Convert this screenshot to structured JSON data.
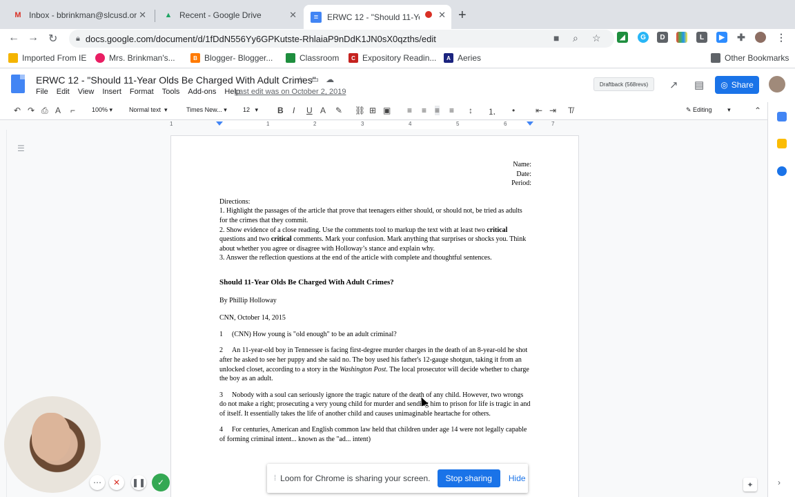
{
  "tabs": [
    {
      "title": "Inbox - bbrinkman@slcusd.org",
      "icon": "gmail-icon",
      "glyph": "M",
      "color": "#d93025"
    },
    {
      "title": "Recent - Google Drive",
      "icon": "drive-icon",
      "glyph": "▲",
      "color": "#1fa463"
    },
    {
      "title": "ERWC 12 - \"Should 11-Year",
      "icon": "docs-icon",
      "glyph": "≡",
      "color": "#4285f4"
    }
  ],
  "address": {
    "url": "docs.google.com/document/d/1fDdN556Yy6GPKutste-RhlaiaP9nDdK1JN0sX0qzths/edit"
  },
  "bookmarks": [
    {
      "label": "Imported From IE",
      "color": "#f4b400"
    },
    {
      "label": "Mrs. Brinkman's...",
      "color": "#e91e63"
    },
    {
      "label": "Blogger- Blogger...",
      "color": "#ff7a00"
    },
    {
      "label": "Classroom",
      "color": "#1e8e3e"
    },
    {
      "label": "Expository Readin...",
      "color": "#c5221f"
    },
    {
      "label": "Aeries",
      "color": "#1a237e"
    }
  ],
  "other_bookmarks": "Other Bookmarks",
  "doc": {
    "title": "ERWC 12 - \"Should 11-Year Olds Be Charged With Adult Crimes\"",
    "menu": [
      "File",
      "Edit",
      "View",
      "Insert",
      "Format",
      "Tools",
      "Add-ons",
      "Help"
    ],
    "last_edit": "Last edit was on October 2, 2019",
    "draftback": "Draftback (568revs)",
    "share": "Share"
  },
  "format": {
    "zoom": "100%",
    "style": "Normal text",
    "font": "Times New...",
    "size": "12",
    "mode": "Editing"
  },
  "ruler_ticks": [
    "1",
    "1",
    "2",
    "3",
    "4",
    "5",
    "6",
    "7"
  ],
  "content": {
    "name": "Name:",
    "date": "Date:",
    "period": "Period:",
    "directions": "Directions:",
    "d1": "1. Highlight the passages of the article that prove that teenagers either should, or should not, be tried as adults for the crimes that they commit.",
    "d2a": "2. Show evidence of a close reading. Use the comments tool to markup the text with at least two",
    "d2b": "critical",
    "d2c": " questions and two ",
    "d2d": "critical",
    "d2e": " comments. Mark your confusion.  Mark anything that surprises or shocks you.  Think about whether you agree or disagree with Holloway’s stance and explain why.",
    "d3": "3. Answer the reflection questions at the end of the article with complete and thoughtful sentences.",
    "article_title": "Should 11-Year Olds Be Charged With Adult Crimes?",
    "byline": "By Phillip Holloway",
    "source": "CNN, October 14, 2015",
    "p1_num": "1",
    "p1": "(CNN) How young is \"old enough\" to be an adult criminal?",
    "p2_num": "2",
    "p2a": "An 11-year-old boy in Tennessee is facing first-degree murder charges in the death of an 8-year-old he shot after he asked to see her puppy and she said no. The boy used his father's 12-gauge shotgun, taking it from an unlocked closet, according to a story in the ",
    "p2b": "Washington Post",
    "p2c": ". The local prosecutor will decide whether to charge the boy as an adult.",
    "p3_num": "3",
    "p3": "Nobody with a soul can seriously ignore the tragic nature of the death of any child. However, two wrongs do not make a right; prosecuting a very young child for murder and sending him to prison for life is tragic in and of itself. It essentially takes the life of another child and causes unimaginable heartache for others.",
    "p4_num": "4",
    "p4": "For centuries, American and English common law held that children under age 14 were not legally capable of forming criminal intent... known as the \"ad... intent)"
  },
  "loom": {
    "message": "Loom for Chrome is sharing your screen.",
    "stop": "Stop sharing",
    "hide": "Hide"
  }
}
